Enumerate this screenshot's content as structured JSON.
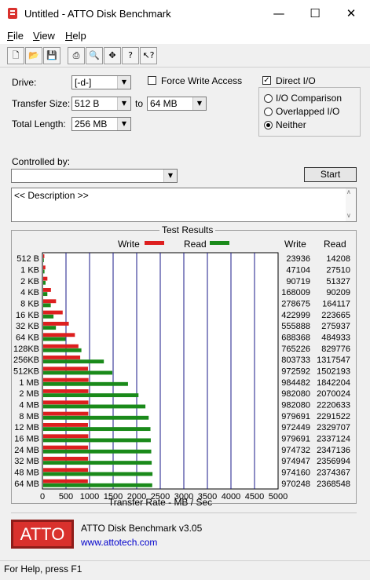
{
  "window": {
    "title": "Untitled - ATTO Disk Benchmark",
    "minimize": "—",
    "maximize": "☐",
    "close": "✕"
  },
  "menu": [
    {
      "hotkey": "F",
      "rest": "ile"
    },
    {
      "hotkey": "V",
      "rest": "iew"
    },
    {
      "hotkey": "H",
      "rest": "elp"
    }
  ],
  "toolbar": [
    "new-icon",
    "open-icon",
    "save-icon",
    "print-icon",
    "print-preview-icon",
    "move-icon",
    "help-icon",
    "context-help-icon"
  ],
  "settings": {
    "drive_label": "Drive:",
    "drive_value": "[-d-]",
    "transfer_size_label": "Transfer Size:",
    "transfer_from": "512 B",
    "to_label": "to",
    "transfer_to": "64 MB",
    "total_length_label": "Total Length:",
    "total_length_value": "256 MB",
    "force_write_access": "Force Write Access",
    "force_write_checked": false,
    "direct_io": "Direct I/O",
    "direct_io_checked": true,
    "io_options": [
      "I/O Comparison",
      "Overlapped I/O",
      "Neither"
    ],
    "io_selected": "Neither",
    "controlled_by_label": "Controlled by:",
    "controlled_by_value": "",
    "start_button": "Start",
    "description": "<< Description >>"
  },
  "results": {
    "title": "Test Results",
    "legend_write": "Write",
    "legend_read": "Read",
    "col_write": "Write",
    "col_read": "Read",
    "write_color": "#dd1f1f",
    "read_color": "#1a8a1a"
  },
  "chart_data": {
    "type": "bar",
    "orientation": "horizontal",
    "categories": [
      "512 B",
      "1 KB",
      "2 KB",
      "4 KB",
      "8 KB",
      "16 KB",
      "32 KB",
      "64 KB",
      "128KB",
      "256KB",
      "512KB",
      "1 MB",
      "2 MB",
      "4 MB",
      "8 MB",
      "12 MB",
      "16 MB",
      "24 MB",
      "32 MB",
      "48 MB",
      "64 MB"
    ],
    "series": [
      {
        "name": "Write",
        "values": [
          23936,
          47104,
          90719,
          168009,
          278675,
          422999,
          555888,
          688368,
          765226,
          803733,
          972592,
          984482,
          982080,
          982080,
          979691,
          972449,
          979691,
          974732,
          974947,
          974160,
          970248
        ]
      },
      {
        "name": "Read",
        "values": [
          14208,
          27510,
          51327,
          90209,
          164117,
          223665,
          275937,
          484933,
          829776,
          1317547,
          1502193,
          1842204,
          2070024,
          2220633,
          2291522,
          2329707,
          2337124,
          2347136,
          2356994,
          2374367,
          2368548
        ]
      }
    ],
    "xlabel": "Transfer Rate - MB / Sec",
    "xlim": [
      0,
      5000
    ],
    "xticks": [
      "0",
      "500",
      "1000",
      "1500",
      "2000",
      "2500",
      "3000",
      "3500",
      "4000",
      "4500",
      "5000"
    ],
    "value_scale": "KB/s"
  },
  "footer": {
    "product": "ATTO Disk Benchmark v3.05",
    "url": "www.attotech.com",
    "logo_text": "ATTO"
  },
  "status": "For Help, press F1"
}
